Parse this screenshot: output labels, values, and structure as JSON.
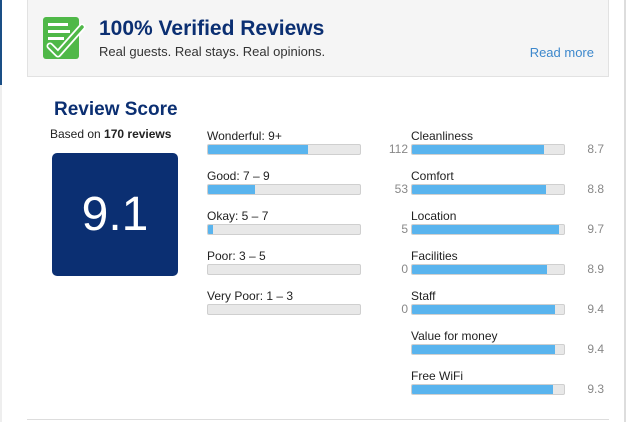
{
  "banner": {
    "title": "100% Verified Reviews",
    "subtitle": "Real guests. Real stays. Real opinions.",
    "read_more": "Read more",
    "icon": "verified-checklist-icon",
    "accent": "#4fb848"
  },
  "score": {
    "title": "Review Score",
    "based_on_prefix": "Based on ",
    "review_count": "170 reviews",
    "value": "9.1",
    "box_color": "#0b2f72"
  },
  "distribution": [
    {
      "label": "Wonderful: 9+",
      "count": "112",
      "fraction": 0.66
    },
    {
      "label": "Good: 7 – 9",
      "count": "53",
      "fraction": 0.31
    },
    {
      "label": "Okay: 5 – 7",
      "count": "5",
      "fraction": 0.03
    },
    {
      "label": "Poor: 3 – 5",
      "count": "0",
      "fraction": 0
    },
    {
      "label": "Very Poor: 1 – 3",
      "count": "0",
      "fraction": 0
    }
  ],
  "categories": [
    {
      "label": "Cleanliness",
      "score": "8.7",
      "fraction": 0.87
    },
    {
      "label": "Comfort",
      "score": "8.8",
      "fraction": 0.88
    },
    {
      "label": "Location",
      "score": "9.7",
      "fraction": 0.97
    },
    {
      "label": "Facilities",
      "score": "8.9",
      "fraction": 0.89
    },
    {
      "label": "Staff",
      "score": "9.4",
      "fraction": 0.94
    },
    {
      "label": "Value for money",
      "score": "9.4",
      "fraction": 0.94
    },
    {
      "label": "Free WiFi",
      "score": "9.3",
      "fraction": 0.93
    }
  ],
  "colors": {
    "bar_fill": "#59b4ee",
    "link": "#3d88cc",
    "heading": "#0b2f72"
  }
}
